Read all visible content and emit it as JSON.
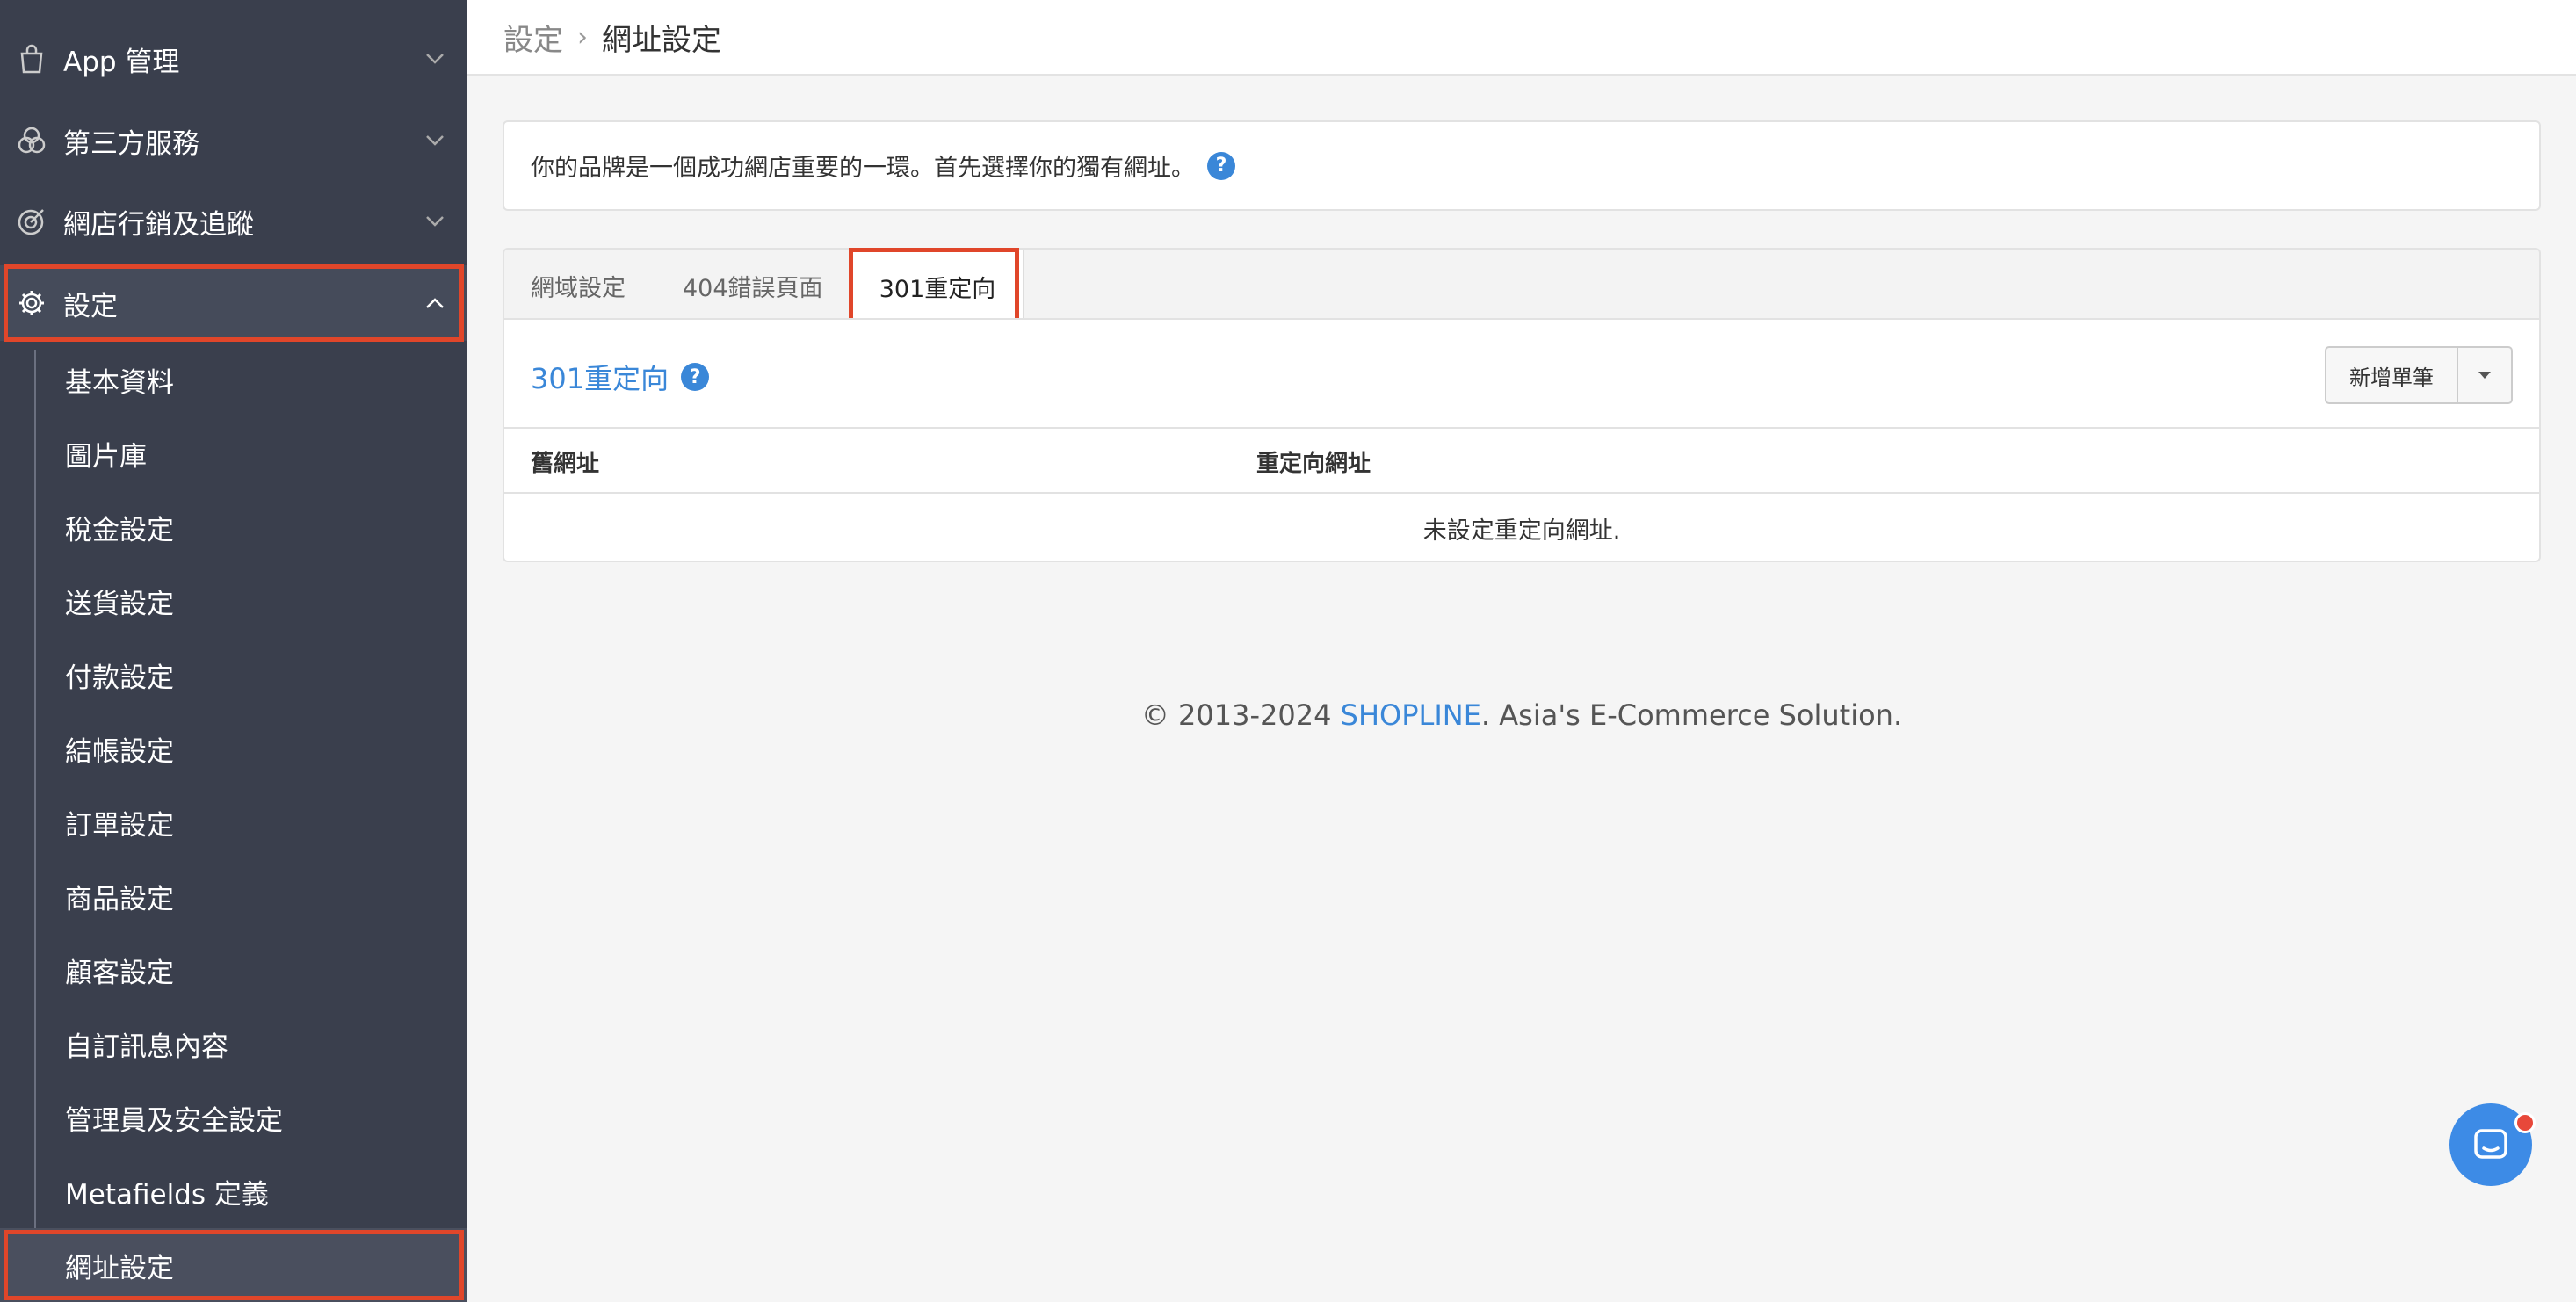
{
  "sidebar": {
    "top_items": [
      {
        "label": "App 管理",
        "icon": "shopping-bag-icon"
      },
      {
        "label": "第三方服務",
        "icon": "venn-icon"
      },
      {
        "label": "網店行銷及追蹤",
        "icon": "target-icon"
      },
      {
        "label": "設定",
        "icon": "gear-icon"
      }
    ],
    "sub_items": [
      {
        "label": "基本資料"
      },
      {
        "label": "圖片庫"
      },
      {
        "label": "稅金設定"
      },
      {
        "label": "送貨設定"
      },
      {
        "label": "付款設定"
      },
      {
        "label": "結帳設定"
      },
      {
        "label": "訂單設定"
      },
      {
        "label": "商品設定"
      },
      {
        "label": "顧客設定"
      },
      {
        "label": "自訂訊息內容"
      },
      {
        "label": "管理員及安全設定"
      },
      {
        "label": "Metafields 定義"
      },
      {
        "label": "網址設定"
      }
    ]
  },
  "breadcrumb": {
    "parent": "設定",
    "separator": "›",
    "current": "網址設定"
  },
  "intro": {
    "text": "你的品牌是一個成功網店重要的一環。首先選擇你的獨有網址。",
    "help": "?"
  },
  "tabs": [
    {
      "label": "網域設定"
    },
    {
      "label": "404錯誤頁面"
    },
    {
      "label": "301重定向"
    }
  ],
  "panel": {
    "title": "301重定向",
    "help": "?",
    "add_button": "新增單筆",
    "columns": [
      "舊網址",
      "重定向網址"
    ],
    "empty_text": "未設定重定向網址."
  },
  "footer": {
    "prefix": "© 2013-2024 ",
    "brand": "SHOPLINE",
    "suffix": ". Asia's E-Commerce Solution."
  },
  "colors": {
    "sidebar": "#3a3f4d",
    "accent": "#3a87d8",
    "highlight": "#e0462a"
  }
}
